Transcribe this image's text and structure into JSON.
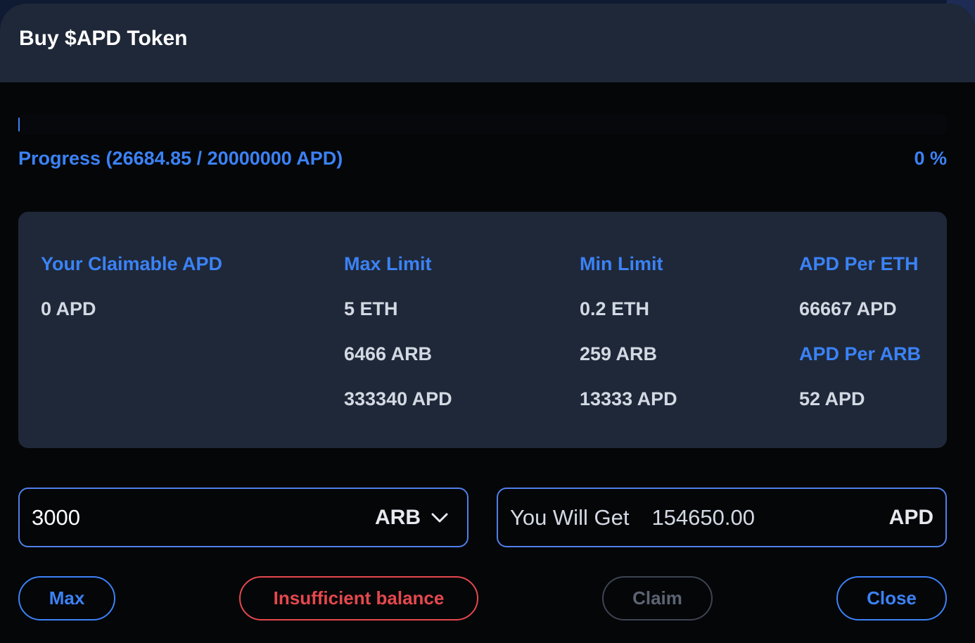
{
  "modal": {
    "title": "Buy $APD Token"
  },
  "progress": {
    "label": "Progress (26684.85 / 20000000 APD)",
    "percent_text": "0 %",
    "fraction": 0.0013
  },
  "stats": {
    "columns": [
      {
        "label": "Your Claimable APD",
        "values": [
          "0 APD"
        ]
      },
      {
        "label": "Max Limit",
        "values": [
          "5 ETH",
          "6466 ARB",
          "333340 APD"
        ]
      },
      {
        "label": "Min Limit",
        "values": [
          "0.2 ETH",
          "259 ARB",
          "13333 APD"
        ]
      },
      {
        "label": "APD Per ETH",
        "value1": "66667 APD",
        "label2": "APD Per ARB",
        "value2": "52 APD"
      }
    ]
  },
  "purchase": {
    "amount_value": "3000",
    "currency": "ARB",
    "you_will_get_label": "You Will Get",
    "you_will_get_amount": "154650.00",
    "output_unit": "APD"
  },
  "buttons": {
    "max": "Max",
    "insufficient": "Insufficient balance",
    "claim": "Claim",
    "close": "Close"
  },
  "colors": {
    "accent": "#3b82f6",
    "error": "#e5484d",
    "card_bg": "#1f2838",
    "modal_bg": "#050608"
  },
  "icons": {
    "currency_dropdown": "chevron-down-icon"
  }
}
